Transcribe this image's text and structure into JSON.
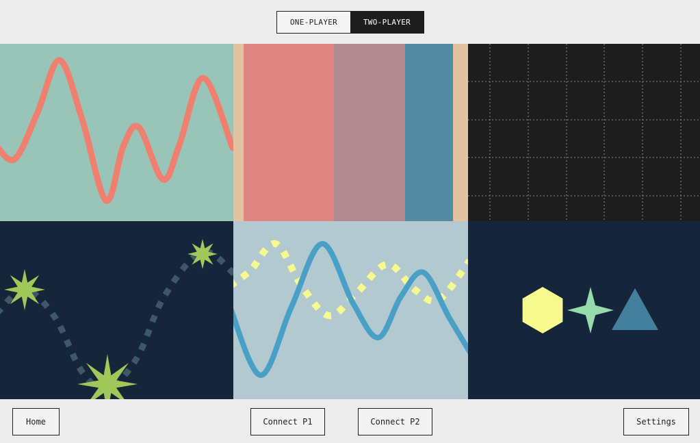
{
  "mode_toggle": {
    "options": [
      "ONE-PLAYER",
      "TWO-PLAYER"
    ],
    "selected": "TWO-PLAYER"
  },
  "footer": {
    "home_label": "Home",
    "connect_p1_label": "Connect P1",
    "connect_p2_label": "Connect P2",
    "settings_label": "Settings"
  },
  "colors": {
    "background": "#ececec",
    "dark": "#1d1d1d",
    "navy": "#16263a",
    "salmon": "#ef8070",
    "mint": "#98c5b8",
    "sand": "#e1c3a1",
    "rose": "#e08682",
    "mauve": "#b08a8e",
    "teal": "#528ba2",
    "light_blue": "#b3c9d0",
    "wave_blue": "#48a0c6",
    "yellow": "#f6f98e",
    "green": "#a0c858",
    "shape_mint": "#96dcaa",
    "shape_teal": "#43809d"
  },
  "tiles": [
    {
      "name": "sine-wave-tile"
    },
    {
      "name": "color-stripes-tile"
    },
    {
      "name": "dotted-grid-tile"
    },
    {
      "name": "stars-path-tile"
    },
    {
      "name": "dual-wave-tile"
    },
    {
      "name": "shapes-tile"
    }
  ]
}
